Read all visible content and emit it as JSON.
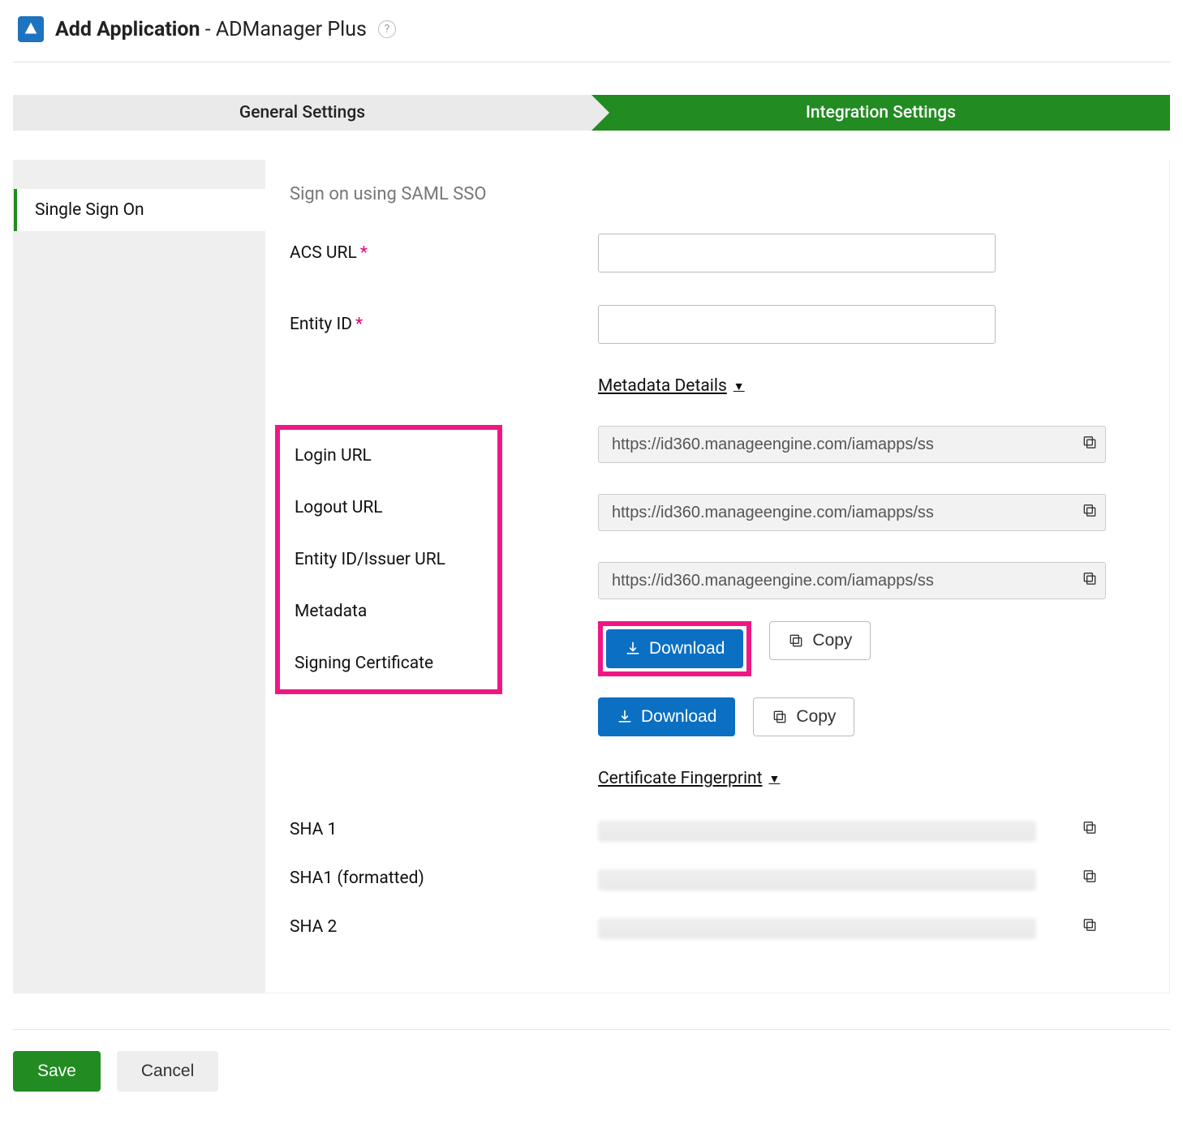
{
  "header": {
    "title_bold": "Add Application",
    "title_rest": " - ADManager Plus"
  },
  "stepper": {
    "inactive": "General Settings",
    "active": "Integration Settings"
  },
  "sidebar": {
    "item": "Single Sign On"
  },
  "content": {
    "signon_title": "Sign on using SAML SSO",
    "acs_label": "ACS URL",
    "entity_label": "Entity ID",
    "metadata_section": "Metadata Details",
    "login_label": "Login URL",
    "logout_label": "Logout URL",
    "issuer_label": "Entity ID/Issuer URL",
    "metadata_label": "Metadata",
    "cert_label": "Signing Certificate",
    "login_value": "https://id360.manageengine.com/iamapps/ss",
    "logout_value": "https://id360.manageengine.com/iamapps/ss",
    "issuer_value": "https://id360.manageengine.com/iamapps/ss",
    "download_label": "Download",
    "copy_label": "Copy",
    "fingerprint_section": "Certificate Fingerprint ",
    "sha1_label": "SHA 1",
    "sha1f_label": "SHA1 (formatted)",
    "sha2_label": "SHA 2"
  },
  "actions": {
    "save": "Save",
    "cancel": "Cancel"
  }
}
